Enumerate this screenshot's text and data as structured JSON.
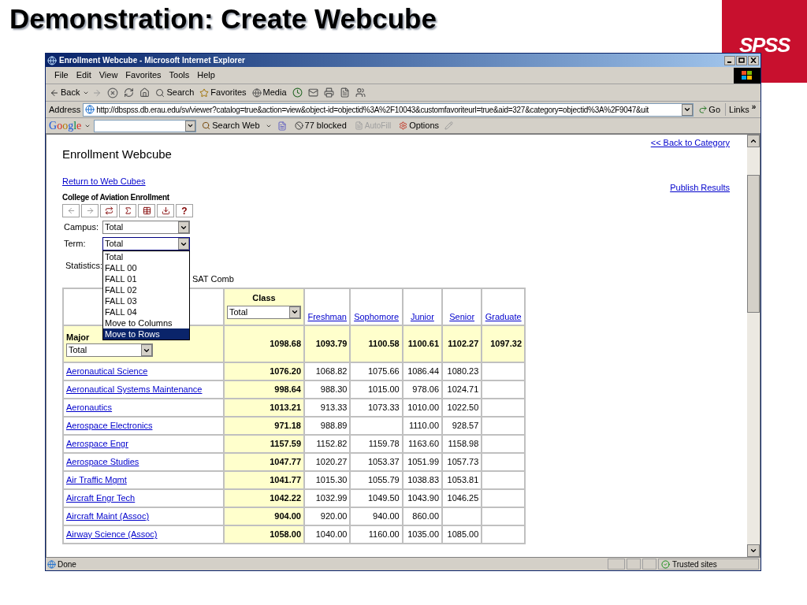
{
  "slide": {
    "title": "Demonstration: Create Webcube",
    "logo": "SPSS"
  },
  "window": {
    "title": "Enrollment Webcube - Microsoft Internet Explorer"
  },
  "menu": [
    "File",
    "Edit",
    "View",
    "Favorites",
    "Tools",
    "Help"
  ],
  "toolbar_labels": [
    "Back",
    "Search",
    "Favorites",
    "Media"
  ],
  "address": {
    "label": "Address",
    "url": "http://dbspss.db.erau.edu/sv/viewer?catalog=true&action=view&object-id=objectid%3A%2F10043&customfavoriteurl=true&aid=327&category=objectid%3A%2F9047&uit",
    "go": "Go",
    "links": "Links",
    "links_more": "»"
  },
  "google_bar": {
    "logo": "Google",
    "search_button": "Search Web",
    "blocked": "77 blocked",
    "autofill": {
      "label": "AutoFill",
      "disabled": true
    },
    "options": "Options"
  },
  "page": {
    "heading": "Enrollment Webcube",
    "back_link": "<< Back to Category",
    "return_link": "Return to Web Cubes",
    "publish_link": "Publish Results",
    "cube_title": "College of Aviation Enrollment",
    "help_button": "?",
    "filters": [
      {
        "label": "Campus:",
        "value": "Total",
        "expanded": false
      },
      {
        "label": "Term:",
        "value": "Total",
        "expanded": true
      }
    ],
    "term_options": [
      {
        "label": "Total",
        "selected": false
      },
      {
        "label": "FALL 00",
        "selected": false
      },
      {
        "label": "FALL 01",
        "selected": false
      },
      {
        "label": "FALL 02",
        "selected": false
      },
      {
        "label": "FALL 03",
        "selected": false
      },
      {
        "label": "FALL 04",
        "selected": false
      },
      {
        "label": "Move to Columns",
        "selected": false
      },
      {
        "label": "Move to Rows",
        "selected": true
      }
    ],
    "statistics": {
      "label": "Statistics:",
      "value": "SAT Comb"
    }
  },
  "table": {
    "class_label": "Class",
    "class_value": "Total",
    "row_label": "Major",
    "row_value": "Total",
    "columns": [
      "Freshman",
      "Sophomore",
      "Junior",
      "Senior",
      "Graduate"
    ],
    "totals": [
      "1098.68",
      "1093.79",
      "1100.58",
      "1100.61",
      "1102.27",
      "1097.32"
    ],
    "rows": [
      {
        "major": "Aeronautical Science",
        "total": "1076.20",
        "freshman": "1068.82",
        "sophomore": "1075.66",
        "junior": "1086.44",
        "senior": "1080.23"
      },
      {
        "major": "Aeronautical Systems Maintenance",
        "total": "998.64",
        "freshman": "988.30",
        "sophomore": "1015.00",
        "junior": "978.06",
        "senior": "1024.71"
      },
      {
        "major": "Aeronautics",
        "total": "1013.21",
        "freshman": "913.33",
        "sophomore": "1073.33",
        "junior": "1010.00",
        "senior": "1022.50"
      },
      {
        "major": "Aerospace Electronics",
        "total": "971.18",
        "freshman": "988.89",
        "junior": "1110.00",
        "senior": "928.57"
      },
      {
        "major": "Aerospace Engr",
        "total": "1157.59",
        "freshman": "1152.82",
        "sophomore": "1159.78",
        "junior": "1163.60",
        "senior": "1158.98"
      },
      {
        "major": "Aerospace Studies",
        "total": "1047.77",
        "freshman": "1020.27",
        "sophomore": "1053.37",
        "junior": "1051.99",
        "senior": "1057.73"
      },
      {
        "major": "Air Traffic Mgmt",
        "total": "1041.77",
        "freshman": "1015.30",
        "sophomore": "1055.79",
        "junior": "1038.83",
        "senior": "1053.81"
      },
      {
        "major": "Aircraft Engr Tech",
        "total": "1042.22",
        "freshman": "1032.99",
        "sophomore": "1049.50",
        "junior": "1043.90",
        "senior": "1046.25"
      },
      {
        "major": "Aircraft Maint (Assoc)",
        "total": "904.00",
        "freshman": "920.00",
        "sophomore": "940.00",
        "junior": "860.00"
      },
      {
        "major": "Airway Science (Assoc)",
        "total": "1058.00",
        "freshman": "1040.00",
        "sophomore": "1160.00",
        "junior": "1035.00",
        "senior": "1085.00"
      }
    ]
  },
  "status_bar": {
    "text": "Done",
    "zone": "Trusted sites"
  }
}
